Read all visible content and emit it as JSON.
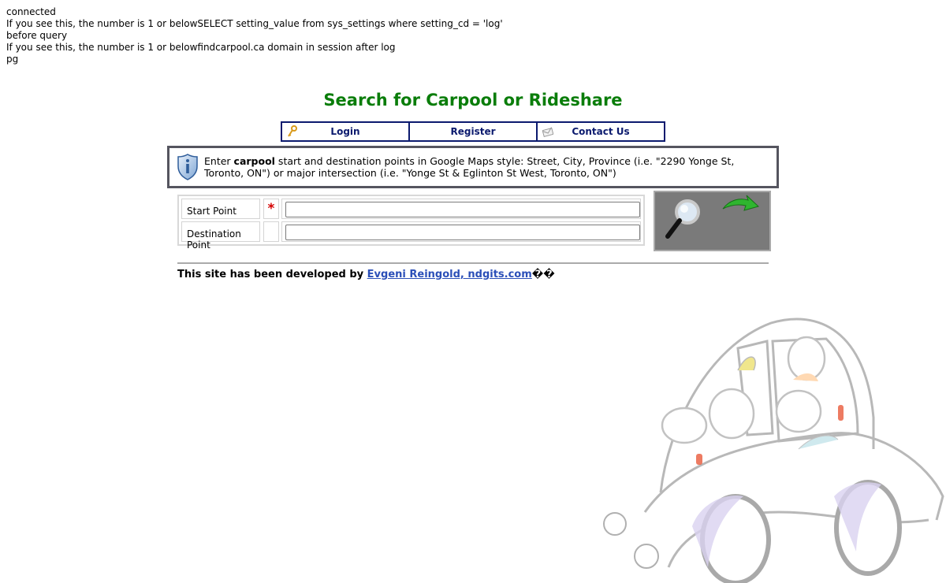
{
  "debug_lines": [
    "connected",
    "If you see this, the number is 1 or belowSELECT setting_value from sys_settings where setting_cd = 'log'",
    "before query",
    "If you see this, the number is 1 or belowfindcarpool.ca domain in session after log",
    "pg"
  ],
  "page_title": "Search for Carpool or Rideshare",
  "nav": {
    "login": {
      "label": "Login",
      "icon": "key-icon"
    },
    "register": {
      "label": "Register"
    },
    "contact": {
      "label": "Contact Us",
      "icon": "envelope-icon"
    }
  },
  "info": {
    "icon": "info-shield-icon",
    "text_before": "Enter ",
    "text_bold": "carpool",
    "text_after": " start and destination points in Google Maps style: Street, City, Province (i.e. \"2290 Yonge St, Toronto, ON\") or major intersection (i.e. \"Yonge St & Eglinton St West, Toronto, ON\")"
  },
  "form": {
    "start_label": "Start Point",
    "required_mark": "*",
    "start_value": "",
    "destination_label": "Destination Point",
    "destination_value": ""
  },
  "search_button": {
    "icons": [
      "magnifier-icon",
      "green-arrow-icon"
    ]
  },
  "footer": {
    "prefix": "This site has been developed by ",
    "link_text": "Evgeni Reingold, ndgits.com",
    "suffix": "��"
  },
  "colors": {
    "title": "#0a7d0a",
    "nav": "#0b1a6e",
    "link": "#2b4fb8",
    "required": "#d40000",
    "search_bg": "#7a7a7a"
  }
}
